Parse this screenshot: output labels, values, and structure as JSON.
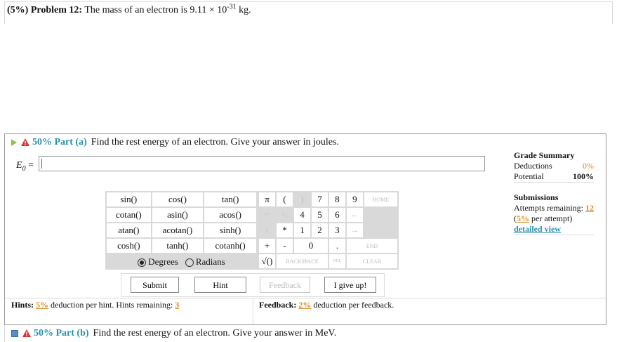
{
  "problem": {
    "prefix": "(5%) Problem 12:",
    "text": "The mass of an electron is 9.11 × 10",
    "exponent": "-31",
    "suffix": "kg."
  },
  "part_a": {
    "label": "50% Part (a)",
    "question": "Find the rest energy of an electron. Give your answer in joules.",
    "answer_var": "E",
    "answer_sub": "0",
    "answer_eq": " =",
    "answer_value": ""
  },
  "grade_summary": {
    "title": "Grade Summary",
    "deductions_label": "Deductions",
    "deductions_value": "0%",
    "potential_label": "Potential",
    "potential_value": "100%"
  },
  "submissions": {
    "title": "Submissions",
    "attempts_label": "Attempts remaining:",
    "attempts_value": "12",
    "per_attempt_pct": "5%",
    "per_attempt_text": "per attempt)",
    "detailed_view": "detailed view"
  },
  "functions": [
    [
      "sin()",
      "cos()",
      "tan()"
    ],
    [
      "cotan()",
      "asin()",
      "acos()"
    ],
    [
      "atan()",
      "acotan()",
      "sinh()"
    ],
    [
      "cosh()",
      "tanh()",
      "cotanh()"
    ]
  ],
  "angle_mode": {
    "degrees": "Degrees",
    "radians": "Radians",
    "selected": "Degrees"
  },
  "keypad": {
    "pi": "π",
    "lparen": "(",
    "rparen": ")",
    "k7": "7",
    "k8": "8",
    "k9": "9",
    "home": "HOME",
    "pow": "↑^",
    "sub": "^↓",
    "k4": "4",
    "k5": "5",
    "k6": "6",
    "left": "←",
    "div": "/",
    "mul": "*",
    "k1": "1",
    "k2": "2",
    "k3": "3",
    "right": "→",
    "plus": "+",
    "minus": "-",
    "k0": "0",
    "dot": ".",
    "end": "END",
    "sqrt": "√()",
    "backspace": "BACKSPACE",
    "del": "DEL",
    "clear": "CLEAR"
  },
  "buttons": {
    "submit": "Submit",
    "hint": "Hint",
    "feedback": "Feedback",
    "give_up": "I give up!"
  },
  "hints": {
    "label": "Hints:",
    "pct": "5%",
    "text": "deduction per hint. Hints remaining:",
    "remaining": "3"
  },
  "feedback": {
    "label": "Feedback:",
    "pct": "2%",
    "text": "deduction per feedback."
  },
  "part_b": {
    "label": "50% Part (b)",
    "question": "Find the rest energy of an electron. Give your answer in MeV."
  },
  "colors": {
    "accent": "#2a8fb0",
    "orange": "#e08a1e",
    "warning": "#d33333",
    "arrow_green": "#8bc34a"
  }
}
